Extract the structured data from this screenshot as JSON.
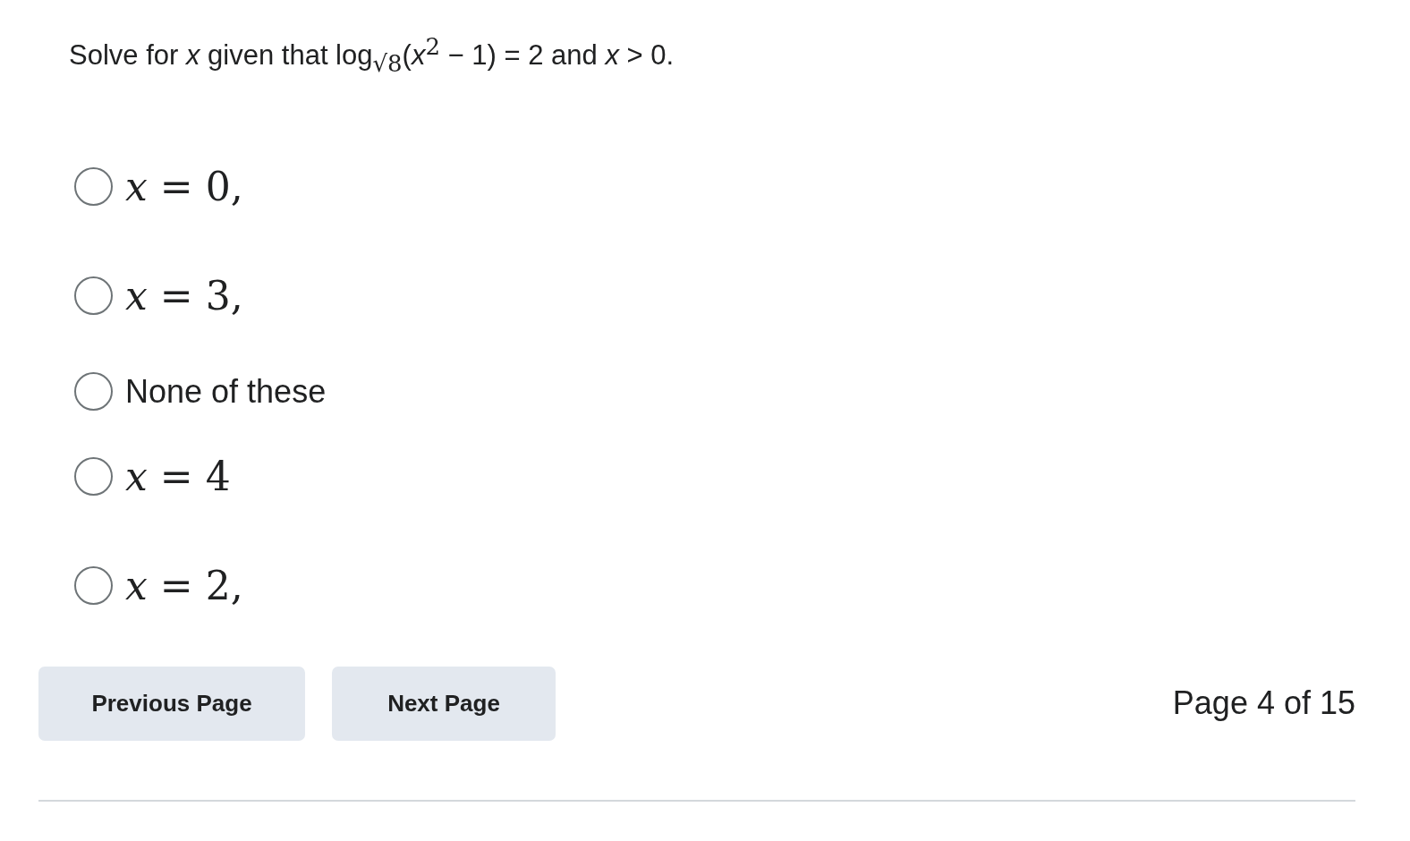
{
  "question": "Solve for *x* given that log$_{√8}$(*x*$^{2}$ − 1) = 2 and *x* > 0.",
  "options": [
    {
      "label": "*x* = 0,",
      "kind": "math",
      "selected": false
    },
    {
      "label": "*x* = 3,",
      "kind": "math",
      "selected": false
    },
    {
      "label": "None of these",
      "kind": "text",
      "selected": false
    },
    {
      "label": "*x* = 4",
      "kind": "math",
      "selected": false
    },
    {
      "label": "*x* = 2,",
      "kind": "math",
      "selected": false
    }
  ],
  "buttons": [
    "Previous Page",
    "Next Page"
  ],
  "page_indicator": "Page 4 of 15"
}
